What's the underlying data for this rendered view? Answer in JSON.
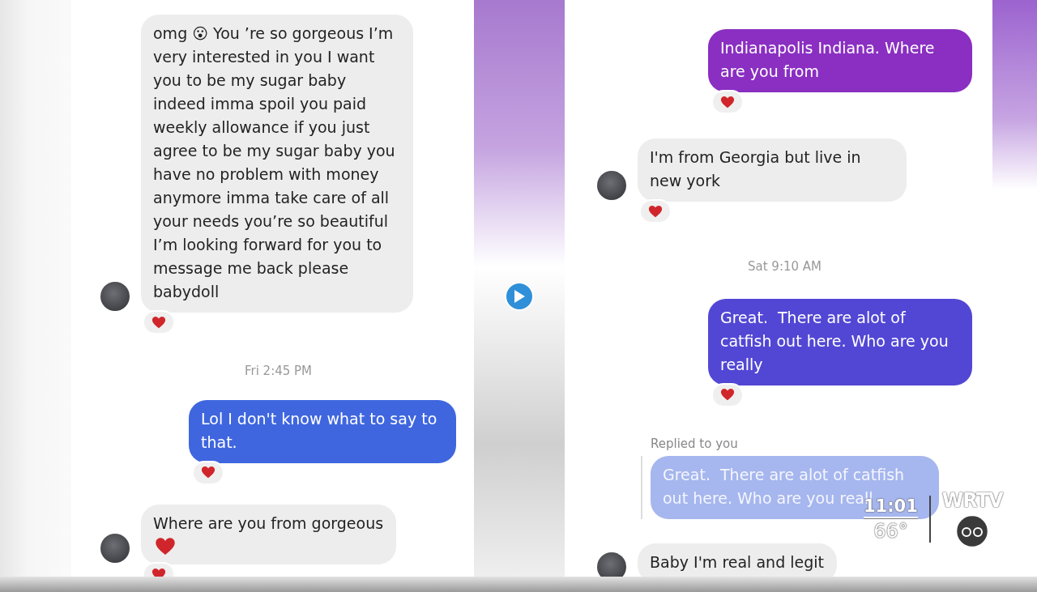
{
  "chats": [
    {
      "messages": [
        {
          "kind": "received",
          "text": "omg 😮 You ’re so gorgeous I’m very interested in you I want you to be my sugar baby indeed imma spoil you paid weekly allowance if you just agree to be my sugar baby you have no problem with money anymore imma take care of all your needs you’re so beautiful I’m looking forward for you to message me back please babydoll",
          "reaction": true
        },
        {
          "kind": "timestamp",
          "text": "Fri 2:45 PM"
        },
        {
          "kind": "sent",
          "text": "Lol I don't know what to say to that.",
          "color": "#3f66df",
          "reaction": true
        },
        {
          "kind": "received",
          "text": "Where are you from gorgeous",
          "trailing_heart": true,
          "reaction": true
        }
      ]
    },
    {
      "messages": [
        {
          "kind": "sent",
          "text": "Indianapolis Indiana. Where are you from",
          "color": "#8a2fc2",
          "reaction": true
        },
        {
          "kind": "received",
          "text": "I'm from Georgia but live in new york",
          "reaction": true
        },
        {
          "kind": "timestamp",
          "text": "Sat 9:10 AM"
        },
        {
          "kind": "sent",
          "text": "Great.  There are alot of catfish out here. Who are you really",
          "color": "#5247d4",
          "reaction": true
        },
        {
          "kind": "reply_label",
          "text": "Replied to you"
        },
        {
          "kind": "quoted",
          "text": "Great.  There are alot of catfish out here. Who are you reall"
        },
        {
          "kind": "received",
          "text": "Baby I'm real and legit",
          "reaction": false
        }
      ]
    }
  ],
  "overlay": {
    "time": "11:01",
    "temperature": "66°",
    "station": "WRTV"
  }
}
